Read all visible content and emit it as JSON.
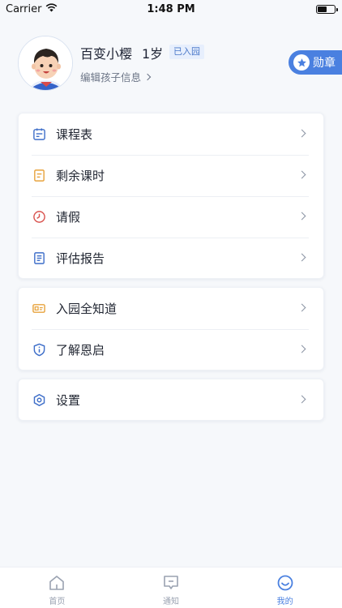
{
  "status_bar": {
    "carrier": "Carrier",
    "time": "1:48 PM"
  },
  "profile": {
    "name": "百变小樱",
    "age": "1岁",
    "enrollment_badge": "已入园",
    "edit_link": "编辑孩子信息",
    "medal_button": "勋章"
  },
  "menu_group_1": [
    {
      "label": "课程表",
      "icon": "calendar-icon"
    },
    {
      "label": "剩余课时",
      "icon": "document-icon"
    },
    {
      "label": "请假",
      "icon": "clock-icon"
    },
    {
      "label": "评估报告",
      "icon": "report-icon"
    }
  ],
  "menu_group_2": [
    {
      "label": "入园全知道",
      "icon": "id-card-icon"
    },
    {
      "label": "了解恩启",
      "icon": "shield-info-icon"
    }
  ],
  "menu_group_3": [
    {
      "label": "设置",
      "icon": "settings-hexagon-icon"
    }
  ],
  "tabbar": [
    {
      "label": "首页",
      "icon": "home-icon"
    },
    {
      "label": "通知",
      "icon": "message-icon"
    },
    {
      "label": "我的",
      "icon": "smiley-icon",
      "active": true
    }
  ],
  "colors": {
    "accent": "#4a80e0",
    "background": "#f6f8fb",
    "orange_icon": "#e8a33d",
    "red_icon": "#d9534f"
  }
}
